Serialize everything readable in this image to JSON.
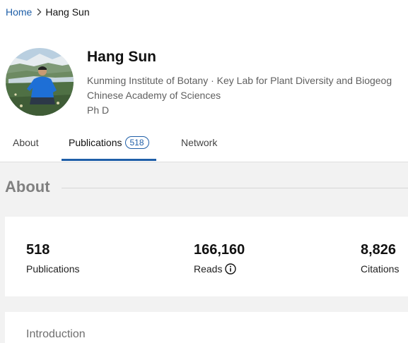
{
  "breadcrumb": {
    "home": "Home",
    "current": "Hang Sun"
  },
  "profile": {
    "name": "Hang Sun",
    "affiliation_line1": "Kunming Institute of Botany · Key Lab for Plant Diversity and Biogeog",
    "affiliation_line2": "Chinese Academy of Sciences",
    "degree": "Ph D"
  },
  "tabs": [
    {
      "label": "About"
    },
    {
      "label": "Publications",
      "badge": "518",
      "active": true
    },
    {
      "label": "Network"
    }
  ],
  "about": {
    "title": "About",
    "stats": [
      {
        "value": "518",
        "label": "Publications"
      },
      {
        "value": "166,160",
        "label": "Reads"
      },
      {
        "value": "8,826",
        "label": "Citations"
      }
    ],
    "introduction_label": "Introduction"
  },
  "colors": {
    "accent": "#1f5fa8",
    "page_bg": "#f2f2f2",
    "section_title": "#808080"
  },
  "icons": {
    "breadcrumb_separator": "chevron-right-icon",
    "reads_info": "info-circle-icon"
  }
}
